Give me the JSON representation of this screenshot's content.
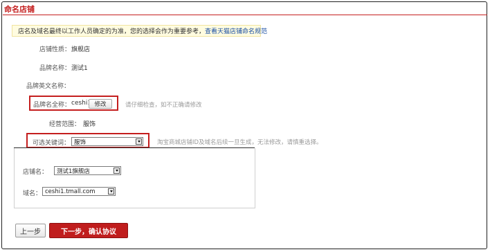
{
  "page": {
    "title": "命名店铺"
  },
  "notice": {
    "text": "店名及域名最终以工作人员确定的为准，您的选择会作为重要参考，",
    "link": "查看天猫店铺命名规范"
  },
  "form": {
    "store_type": {
      "label": "店铺性质：",
      "value": "旗舰店"
    },
    "brand_name": {
      "label": "品牌名称：",
      "value": "测试1"
    },
    "brand_english": {
      "label": "品牌英文名称：",
      "value": ""
    },
    "brand_full": {
      "label": "品牌名全称：",
      "value": "ceshi1",
      "button": "修改",
      "hint": "请仔细检查，如不正确请修改"
    },
    "business_scope": {
      "label": "经营范围：",
      "value": "服饰"
    },
    "keyword": {
      "label": "可选关键词：",
      "selected": "服饰",
      "hint": "淘宝商城店铺ID及域名后续一旦生成，无法修改，请慎重选择。"
    }
  },
  "domain_panel": {
    "store_name": {
      "label": "店铺名：",
      "selected": "测试1旗舰店"
    },
    "domain": {
      "label": "域名：",
      "selected": "ceshi1.tmall.com"
    }
  },
  "actions": {
    "prev": "上一步",
    "next": "下一步，确认协议"
  },
  "colors": {
    "accent": "#c41e1e",
    "link": "#1a4fa3",
    "notice_bg": "#fffce0"
  },
  "icons": {
    "notice": "lightbulb-icon",
    "dropdown": "chevron-down-icon"
  }
}
